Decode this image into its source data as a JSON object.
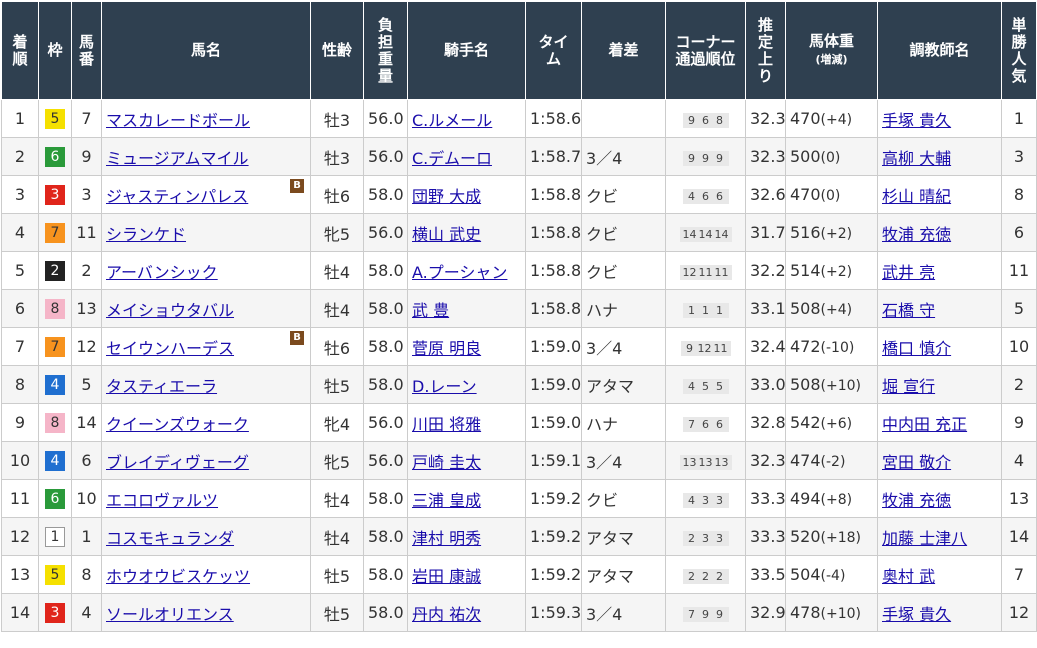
{
  "headers": [
    "着\n順",
    "枠",
    "馬\n番",
    "馬名",
    "性齢",
    "負\n担\n重\n量",
    "騎手名",
    "タイ\nム",
    "着差",
    "コーナー\n通過順位",
    "推\n定\n上\nり",
    "馬体重",
    "調教師名",
    "単\n勝\n人\n気"
  ],
  "weight_sub": "(増減)",
  "blinker_label": "B",
  "frame_colors": {
    "1": "#ffffff",
    "2": "#222222",
    "3": "#e0251b",
    "4": "#1f6fd0",
    "5": "#f5e000",
    "6": "#2a9a3a",
    "7": "#f7931e",
    "8": "#f5b5c8"
  },
  "rows": [
    {
      "rank": "1",
      "frame": "5",
      "num": "7",
      "horse": "マスカレードボール",
      "blinker": false,
      "sexage": "牡3",
      "weight": "56.0",
      "jockey": "C.ルメール",
      "time": "1:58.6",
      "margin": "",
      "corners": [
        "9",
        "6",
        "8"
      ],
      "last3f": "32.3",
      "bw": "470",
      "bwdiff": "(+4)",
      "trainer": "手塚 貴久",
      "pop": "1"
    },
    {
      "rank": "2",
      "frame": "6",
      "num": "9",
      "horse": "ミュージアムマイル",
      "blinker": false,
      "sexage": "牡3",
      "weight": "56.0",
      "jockey": "C.デムーロ",
      "time": "1:58.7",
      "margin": "3／4",
      "corners": [
        "9",
        "9",
        "9"
      ],
      "last3f": "32.3",
      "bw": "500",
      "bwdiff": "(0)",
      "trainer": "高柳 大輔",
      "pop": "3"
    },
    {
      "rank": "3",
      "frame": "3",
      "num": "3",
      "horse": "ジャスティンパレス",
      "blinker": true,
      "sexage": "牡6",
      "weight": "58.0",
      "jockey": "団野 大成",
      "time": "1:58.8",
      "margin": "クビ",
      "corners": [
        "4",
        "6",
        "6"
      ],
      "last3f": "32.6",
      "bw": "470",
      "bwdiff": "(0)",
      "trainer": "杉山 晴紀",
      "pop": "8"
    },
    {
      "rank": "4",
      "frame": "7",
      "num": "11",
      "horse": "シランケド",
      "blinker": false,
      "sexage": "牝5",
      "weight": "56.0",
      "jockey": "横山 武史",
      "time": "1:58.8",
      "margin": "クビ",
      "corners": [
        "14",
        "14",
        "14"
      ],
      "last3f": "31.7",
      "bw": "516",
      "bwdiff": "(+2)",
      "trainer": "牧浦 充徳",
      "pop": "6"
    },
    {
      "rank": "5",
      "frame": "2",
      "num": "2",
      "horse": "アーバンシック",
      "blinker": false,
      "sexage": "牡4",
      "weight": "58.0",
      "jockey": "A.プーシャン",
      "time": "1:58.8",
      "margin": "クビ",
      "corners": [
        "12",
        "11",
        "11"
      ],
      "last3f": "32.2",
      "bw": "514",
      "bwdiff": "(+2)",
      "trainer": "武井 亮",
      "pop": "11"
    },
    {
      "rank": "6",
      "frame": "8",
      "num": "13",
      "horse": "メイショウタバル",
      "blinker": false,
      "sexage": "牡4",
      "weight": "58.0",
      "jockey": "武 豊",
      "time": "1:58.8",
      "margin": "ハナ",
      "corners": [
        "1",
        "1",
        "1"
      ],
      "last3f": "33.1",
      "bw": "508",
      "bwdiff": "(+4)",
      "trainer": "石橋 守",
      "pop": "5"
    },
    {
      "rank": "7",
      "frame": "7",
      "num": "12",
      "horse": "セイウンハーデス",
      "blinker": true,
      "sexage": "牡6",
      "weight": "58.0",
      "jockey": "菅原 明良",
      "time": "1:59.0",
      "margin": "3／4",
      "corners": [
        "9",
        "12",
        "11"
      ],
      "last3f": "32.4",
      "bw": "472",
      "bwdiff": "(-10)",
      "trainer": "橋口 慎介",
      "pop": "10"
    },
    {
      "rank": "8",
      "frame": "4",
      "num": "5",
      "horse": "タスティエーラ",
      "blinker": false,
      "sexage": "牡5",
      "weight": "58.0",
      "jockey": "D.レーン",
      "time": "1:59.0",
      "margin": "アタマ",
      "corners": [
        "4",
        "5",
        "5"
      ],
      "last3f": "33.0",
      "bw": "508",
      "bwdiff": "(+10)",
      "trainer": "堀 宣行",
      "pop": "2"
    },
    {
      "rank": "9",
      "frame": "8",
      "num": "14",
      "horse": "クイーンズウォーク",
      "blinker": false,
      "sexage": "牝4",
      "weight": "56.0",
      "jockey": "川田 将雅",
      "time": "1:59.0",
      "margin": "ハナ",
      "corners": [
        "7",
        "6",
        "6"
      ],
      "last3f": "32.8",
      "bw": "542",
      "bwdiff": "(+6)",
      "trainer": "中内田 充正",
      "pop": "9"
    },
    {
      "rank": "10",
      "frame": "4",
      "num": "6",
      "horse": "ブレイディヴェーグ",
      "blinker": false,
      "sexage": "牝5",
      "weight": "56.0",
      "jockey": "戸崎 圭太",
      "time": "1:59.1",
      "margin": "3／4",
      "corners": [
        "13",
        "13",
        "13"
      ],
      "last3f": "32.3",
      "bw": "474",
      "bwdiff": "(-2)",
      "trainer": "宮田 敬介",
      "pop": "4"
    },
    {
      "rank": "11",
      "frame": "6",
      "num": "10",
      "horse": "エコロヴァルツ",
      "blinker": false,
      "sexage": "牡4",
      "weight": "58.0",
      "jockey": "三浦 皇成",
      "time": "1:59.2",
      "margin": "クビ",
      "corners": [
        "4",
        "3",
        "3"
      ],
      "last3f": "33.3",
      "bw": "494",
      "bwdiff": "(+8)",
      "trainer": "牧浦 充徳",
      "pop": "13"
    },
    {
      "rank": "12",
      "frame": "1",
      "num": "1",
      "horse": "コスモキュランダ",
      "blinker": false,
      "sexage": "牡4",
      "weight": "58.0",
      "jockey": "津村 明秀",
      "time": "1:59.2",
      "margin": "アタマ",
      "corners": [
        "2",
        "3",
        "3"
      ],
      "last3f": "33.3",
      "bw": "520",
      "bwdiff": "(+18)",
      "trainer": "加藤 士津八",
      "pop": "14"
    },
    {
      "rank": "13",
      "frame": "5",
      "num": "8",
      "horse": "ホウオウビスケッツ",
      "blinker": false,
      "sexage": "牡5",
      "weight": "58.0",
      "jockey": "岩田 康誠",
      "time": "1:59.2",
      "margin": "アタマ",
      "corners": [
        "2",
        "2",
        "2"
      ],
      "last3f": "33.5",
      "bw": "504",
      "bwdiff": "(-4)",
      "trainer": "奥村 武",
      "pop": "7"
    },
    {
      "rank": "14",
      "frame": "3",
      "num": "4",
      "horse": "ソールオリエンス",
      "blinker": false,
      "sexage": "牡5",
      "weight": "58.0",
      "jockey": "丹内 祐次",
      "time": "1:59.3",
      "margin": "3／4",
      "corners": [
        "7",
        "9",
        "9"
      ],
      "last3f": "32.9",
      "bw": "478",
      "bwdiff": "(+10)",
      "trainer": "手塚 貴久",
      "pop": "12"
    }
  ]
}
